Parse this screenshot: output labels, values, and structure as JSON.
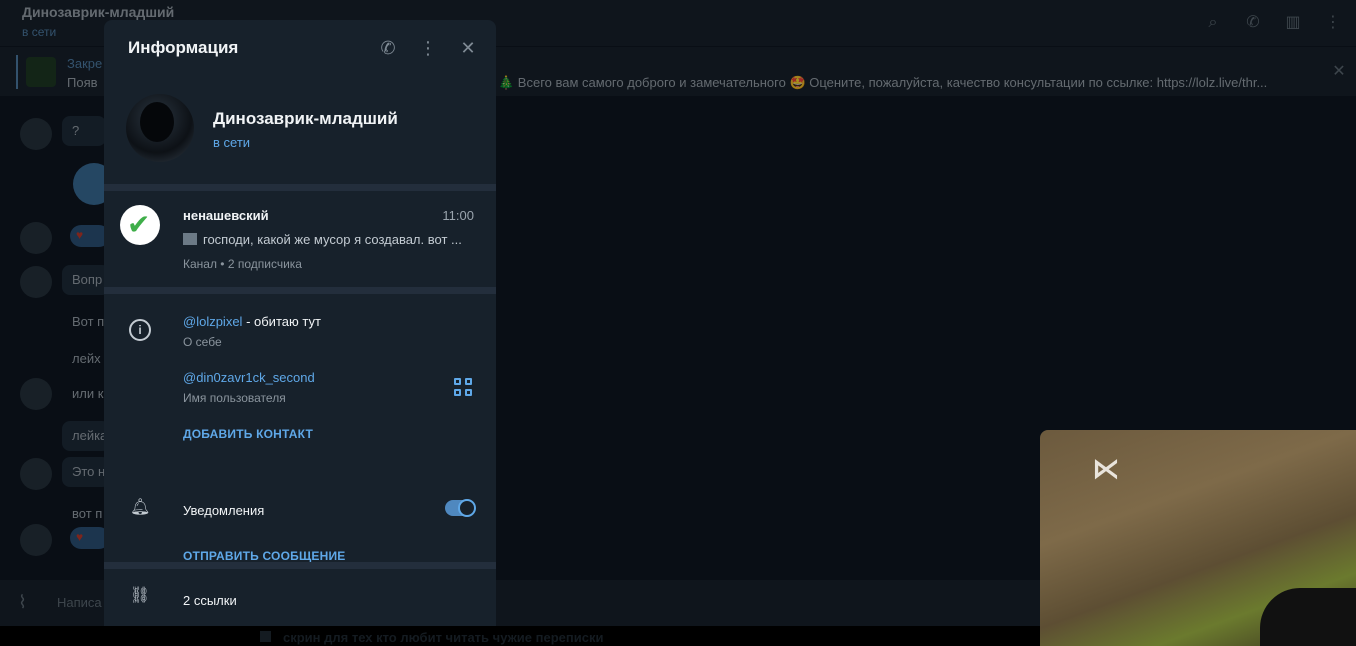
{
  "chat": {
    "title": "Динозаврик-младший",
    "status": "в сети",
    "pinned_label": "Закре",
    "pinned_text": "Появ",
    "pinned_long": "🎄 Всего вам самого доброго и замечательного 🤩 Оцените, пожалуйста, качество консультации по ссылке:  https://lolz.live/thr...",
    "messages": [
      "?",
      "Вопр",
      "Вот п",
      "лейх",
      "или к",
      "лейка",
      "Это н",
      "вот п"
    ],
    "composer_placeholder": "Написа",
    "bottom_caption": "скрин для тех кто любит читать чужие переписки"
  },
  "panel": {
    "title": "Информация",
    "name": "Динозаврик-младший",
    "status": "в сети",
    "channel": {
      "name": "ненашевский",
      "time": "11:00",
      "preview": "господи, какой же мусор я создавал. вот ...",
      "meta": "Канал • 2 подписчика"
    },
    "bio_link": "@lolzpixel",
    "bio_rest": " - обитаю тут",
    "bio_caption": "О себе",
    "username": "@din0zavr1ck_second",
    "username_caption": "Имя пользователя",
    "add_contact": "ДОБАВИТЬ КОНТАКТ",
    "notifications_label": "Уведомления",
    "notifications_on": true,
    "send_message": "ОТПРАВИТЬ СООБЩЕНИЕ",
    "links_label": "2 ссылки"
  },
  "colors": {
    "accent": "#5fa8e8",
    "panel_bg": "#17212b",
    "app_bg": "#0e1621"
  },
  "icons": [
    "search-icon",
    "phone-icon",
    "sidebar-icon",
    "more-icon",
    "close-icon",
    "info-icon",
    "qr-code-icon",
    "bell-icon",
    "link-icon",
    "clip-icon"
  ]
}
